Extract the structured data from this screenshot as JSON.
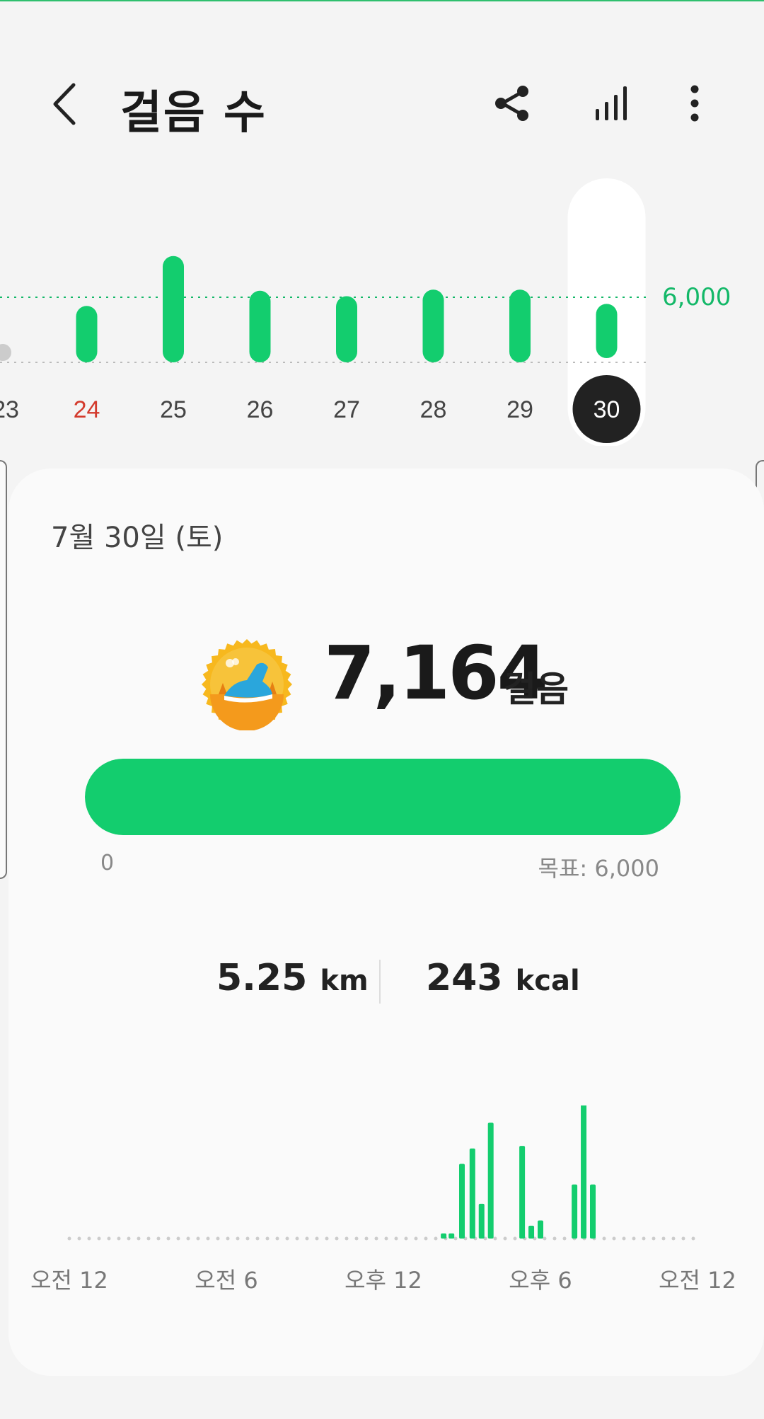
{
  "header": {
    "title": "걸음 수",
    "icons": [
      "back-arrow-icon",
      "share-icon",
      "bar-chart-icon",
      "more-vertical-icon"
    ]
  },
  "week_chart": {
    "goal_label": "6,000",
    "colors": {
      "bar": "#13cd6e",
      "sunday": "#d33a2c",
      "selected_bg": "#222222"
    },
    "selected_index": 7
  },
  "card": {
    "date": "7월 30일 (토)",
    "steps": "7,164",
    "steps_unit": "걸음",
    "progress_min": "0",
    "progress_goal": "목표: 6,000",
    "progress_fraction": 1.0,
    "distance_value": "5.25",
    "distance_unit": "km",
    "calories_value": "243",
    "calories_unit": "kcal"
  },
  "chart_data": [
    {
      "type": "bar",
      "categories": [
        "23",
        "24",
        "25",
        "26",
        "27",
        "28",
        "29",
        "30"
      ],
      "values": [
        2000,
        5200,
        9800,
        6600,
        6100,
        6700,
        6700,
        5000
      ],
      "goal_line": 6000,
      "xlabel": "",
      "ylabel": ""
    },
    {
      "type": "bar",
      "x_tick_labels": [
        "오전 12",
        "오전 6",
        "오후 12",
        "오후 6",
        "오전 12"
      ],
      "x_start": 0,
      "x_end": 24,
      "x": [
        14.3,
        14.6,
        15.0,
        15.4,
        15.75,
        16.1,
        17.3,
        17.65,
        18.0,
        19.3,
        19.65,
        20.0
      ],
      "values": [
        4,
        4,
        58,
        70,
        27,
        90,
        72,
        10,
        14,
        42,
        110,
        42
      ],
      "ylim": [
        0,
        110
      ],
      "xlabel": "",
      "ylabel": ""
    }
  ]
}
